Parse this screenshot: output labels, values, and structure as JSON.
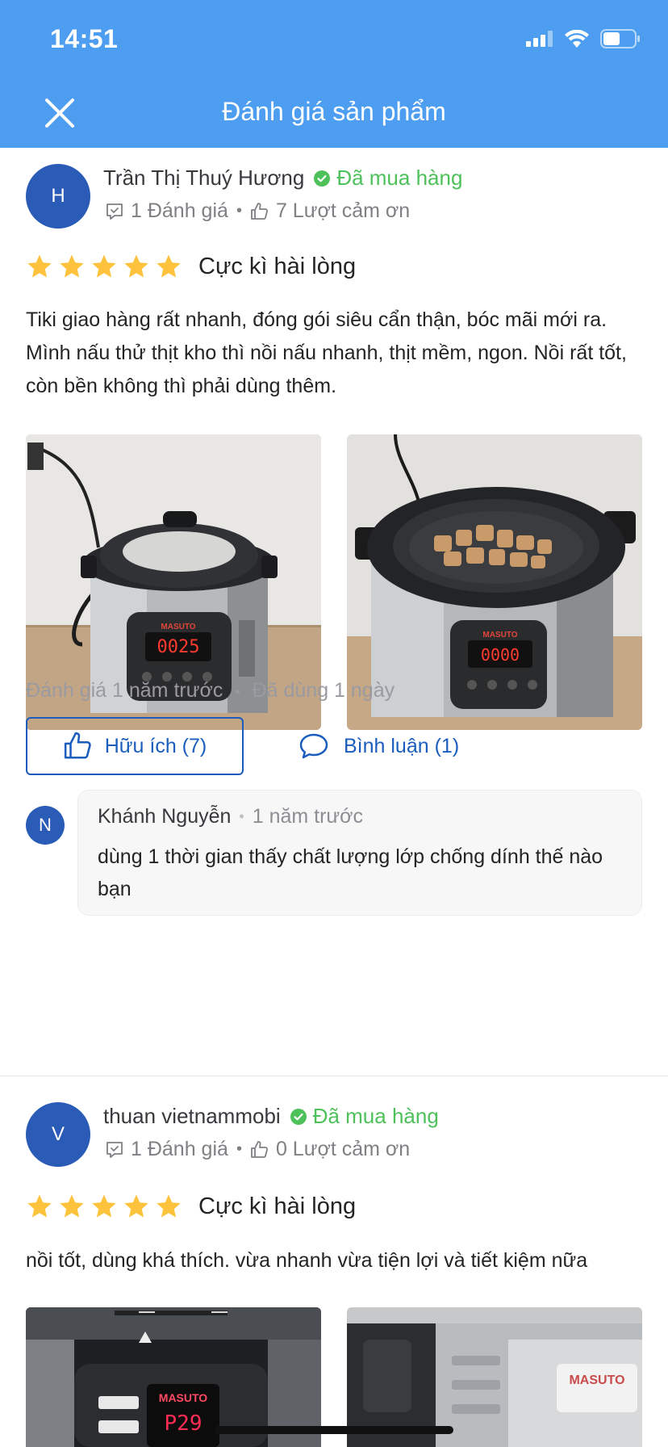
{
  "status_bar": {
    "time": "14:51"
  },
  "header": {
    "title": "Đánh giá sản phẩm",
    "close_icon": "close-icon",
    "background": "#4d9df0"
  },
  "reviews": [
    {
      "avatar_initial": "H",
      "name": "Trần Thị Thuý Hương",
      "purchased_label": "Đã mua hàng",
      "review_count": "1 Đánh giá",
      "thanks_count": "7 Lượt cảm ơn",
      "rating": 5,
      "rating_label": "Cực kì hài lòng",
      "text": "Tiki giao hàng rất nhanh, đóng gói siêu cẩn thận, bóc mãi mới ra. Mình nấu thử thịt kho thì nồi nấu nhanh, thịt mềm, ngon. Nồi rất tốt, còn bền không thì phải dùng thêm.",
      "photo_display_left": "0025",
      "photo_display_right": "0000",
      "photo_brand": "MASUTO",
      "date": "Đánh giá 1 năm trước",
      "used": "Đã dùng 1 ngày",
      "helpful_label": "Hữu ích (7)",
      "comment_label": "Bình luận (1)",
      "comment": {
        "avatar_initial": "N",
        "author": "Khánh Nguyễn",
        "time": "1 năm trước",
        "text": "dùng 1 thời gian thấy chất lượng lớp chống dính thế nào bạn"
      }
    },
    {
      "avatar_initial": "V",
      "name": "thuan vietnammobi",
      "purchased_label": "Đã mua hàng",
      "review_count": "1 Đánh giá",
      "thanks_count": "0 Lượt cảm ơn",
      "rating": 5,
      "rating_label": "Cực kì hài lòng",
      "text": "nồi tốt, dùng khá thích. vừa nhanh vừa tiện lợi và tiết kiệm nữa",
      "photo_brand": "MASUTO",
      "photo_display_left": "P29"
    }
  ],
  "colors": {
    "accent": "#1a5dbd",
    "star": "#fdc33c",
    "verified": "#4ec15b"
  }
}
